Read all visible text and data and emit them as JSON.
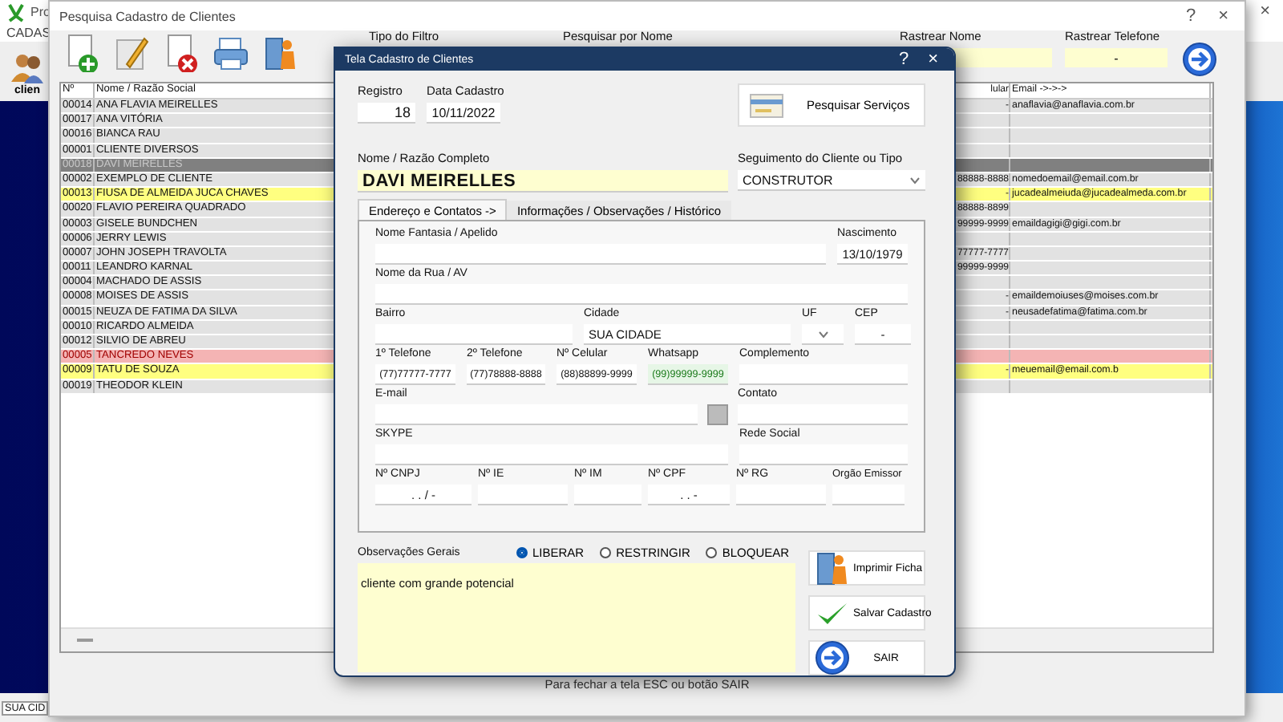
{
  "app": {
    "title": "Pro",
    "close": "×",
    "menu": [
      "CADAS"
    ],
    "toolbar_label": "clien",
    "status_field": "SUA CID"
  },
  "search_window": {
    "title": "Pesquisa Cadastro de Clientes",
    "help": "?",
    "close": "×",
    "filters": [
      {
        "label": "Tipo do Filtro"
      },
      {
        "label": "Pesquisar por Nome"
      },
      {
        "label": "Rastrear Nome"
      },
      {
        "label": "Rastrear Telefone",
        "value": "-"
      }
    ],
    "table": {
      "columns": [
        "Nº",
        "Nome / Razão Social",
        "",
        "lular",
        "Email ->->->"
      ],
      "rows": [
        {
          "num": "00014",
          "name": "ANA FLAVIA MEIRELLES",
          "celular": "-",
          "email": "anaflavia@anaflavia.com.br",
          "restricted": false,
          "blocked": false,
          "selected": false
        },
        {
          "num": "00017",
          "name": "ANA VITÓRIA",
          "restricted": false,
          "blocked": false,
          "selected": false
        },
        {
          "num": "00016",
          "name": "BIANCA RAU",
          "restricted": false,
          "blocked": false,
          "selected": false
        },
        {
          "num": "00001",
          "name": "CLIENTE DIVERSOS",
          "restricted": false,
          "blocked": false,
          "selected": false
        },
        {
          "num": "00018",
          "name": "DAVI MEIRELLES",
          "restricted": false,
          "blocked": false,
          "selected": true
        },
        {
          "num": "00002",
          "name": "EXEMPLO DE CLIENTE",
          "celular": "88888-8888",
          "email": "nomedoemail@email.com.br",
          "restricted": false,
          "blocked": false,
          "selected": false
        },
        {
          "num": "00013",
          "name": "FIUSA DE ALMEIDA JUCA CHAVES",
          "celular": "-",
          "email": "jucadealmeiuda@jucadealmeda.com.br",
          "restricted": true,
          "blocked": false,
          "selected": false
        },
        {
          "num": "00020",
          "name": "FLAVIO PEREIRA QUADRADO",
          "celular": "88888-8899",
          "restricted": false,
          "blocked": false,
          "selected": false
        },
        {
          "num": "00003",
          "name": "GISELE BUNDCHEN",
          "celular": "99999-9999",
          "email": "emaildagigi@gigi.com.br",
          "restricted": false,
          "blocked": false,
          "selected": false
        },
        {
          "num": "00006",
          "name": "JERRY LEWIS",
          "restricted": false,
          "blocked": false,
          "selected": false
        },
        {
          "num": "00007",
          "name": "JOHN JOSEPH TRAVOLTA",
          "celular": "77777-7777",
          "restricted": false,
          "blocked": false,
          "selected": false
        },
        {
          "num": "00011",
          "name": "LEANDRO KARNAL",
          "celular": "99999-9999",
          "restricted": false,
          "blocked": false,
          "selected": false
        },
        {
          "num": "00004",
          "name": "MACHADO DE ASSIS",
          "restricted": false,
          "blocked": false,
          "selected": false
        },
        {
          "num": "00008",
          "name": "MOISES DE ASSIS",
          "celular": "-",
          "email": "emaildemoiuses@moises.com.br",
          "restricted": false,
          "blocked": false,
          "selected": false
        },
        {
          "num": "00015",
          "name": "NEUZA DE FATIMA DA SILVA",
          "celular": "-",
          "email": "neusadefatima@fatima.com.br",
          "restricted": false,
          "blocked": false,
          "selected": false
        },
        {
          "num": "00010",
          "name": "RICARDO ALMEIDA",
          "restricted": false,
          "blocked": false,
          "selected": false
        },
        {
          "num": "00012",
          "name": "SILVIO DE ABREU",
          "restricted": false,
          "blocked": false,
          "selected": false
        },
        {
          "num": "00005",
          "name": "TANCREDO NEVES",
          "restricted": false,
          "blocked": true,
          "selected": false
        },
        {
          "num": "00009",
          "name": "TATU DE SOUZA",
          "celular": "-",
          "email": "meuemail@email.com.b",
          "restricted": true,
          "blocked": false,
          "selected": false
        },
        {
          "num": "00019",
          "name": "THEODOR KLEIN",
          "restricted": false,
          "blocked": false,
          "selected": false
        }
      ]
    },
    "footer": "Para fechar a tela ESC ou botão SAIR"
  },
  "dialog": {
    "title": "Tela Cadastro de Clientes",
    "help": "?",
    "close": "×",
    "registro": {
      "label": "Registro",
      "value": "18"
    },
    "data_cadastro": {
      "label": "Data Cadastro",
      "value": "10/11/2022"
    },
    "services_button": "Pesquisar Serviços",
    "nome": {
      "label": "Nome / Razão Completo",
      "value": "DAVI MEIRELLES"
    },
    "segmento": {
      "label": "Seguimento do Cliente ou Tipo",
      "value": "CONSTRUTOR"
    },
    "tabs": [
      {
        "label": "Endereço e Contatos ->",
        "selected": true
      },
      {
        "label": "Informações / Observações / Histórico",
        "selected": false
      }
    ],
    "form_rows": [
      [
        {
          "kind": "text",
          "label": "Nome Fantasia / Apelido"
        },
        {
          "kind": "text",
          "label": "Nascimento",
          "value": "13/10/1979"
        }
      ],
      [
        {
          "kind": "text",
          "label": "Nome da Rua / AV"
        }
      ],
      [
        {
          "kind": "text",
          "label": "Bairro"
        },
        {
          "kind": "text",
          "label": "Cidade",
          "value": "SUA CIDADE"
        },
        {
          "kind": "select",
          "label": "UF"
        },
        {
          "kind": "text",
          "label": "CEP",
          "value": "-"
        }
      ],
      [
        {
          "kind": "text",
          "label": "1º Telefone",
          "value": "(77)77777-7777"
        },
        {
          "kind": "text",
          "label": "2º Telefone",
          "value": "(77)78888-8888"
        },
        {
          "kind": "text",
          "label": "Nº Celular",
          "value": "(88)88899-9999"
        },
        {
          "kind": "text",
          "label": "Whatsapp",
          "value": "(99)99999-9999",
          "color": "#e6f6e6"
        },
        {
          "kind": "text",
          "label": "Complemento"
        }
      ],
      [
        {
          "kind": "text",
          "label": "E-mail"
        },
        {
          "kind": "button"
        },
        {
          "kind": "text",
          "label": "Contato"
        }
      ],
      [
        {
          "kind": "text",
          "label": "SKYPE"
        },
        {
          "kind": "text",
          "label": "Rede Social"
        }
      ],
      [
        {
          "kind": "text",
          "label": "Nº CNPJ",
          "value": ". . / -"
        },
        {
          "kind": "text",
          "label": "Nº IE"
        },
        {
          "kind": "text",
          "label": "Nº IM"
        },
        {
          "kind": "text",
          "label": "Nº CPF",
          "value": ". . -"
        },
        {
          "kind": "text",
          "label": "Nº RG"
        },
        {
          "kind": "text",
          "label": "Orgão Emissor"
        }
      ]
    ],
    "obs_label": "Observações Gerais",
    "radios": [
      {
        "label": "LIBERAR",
        "selected": true
      },
      {
        "label": "RESTRINGIR",
        "selected": false
      },
      {
        "label": "BLOQUEAR",
        "selected": false
      }
    ],
    "obs_text": "cliente com grande potencial",
    "actions": [
      {
        "kind": "print",
        "label": "Imprimir Ficha"
      },
      {
        "kind": "save",
        "label": "Salvar Cadastro"
      },
      {
        "kind": "exit",
        "label": "SAIR"
      }
    ]
  }
}
